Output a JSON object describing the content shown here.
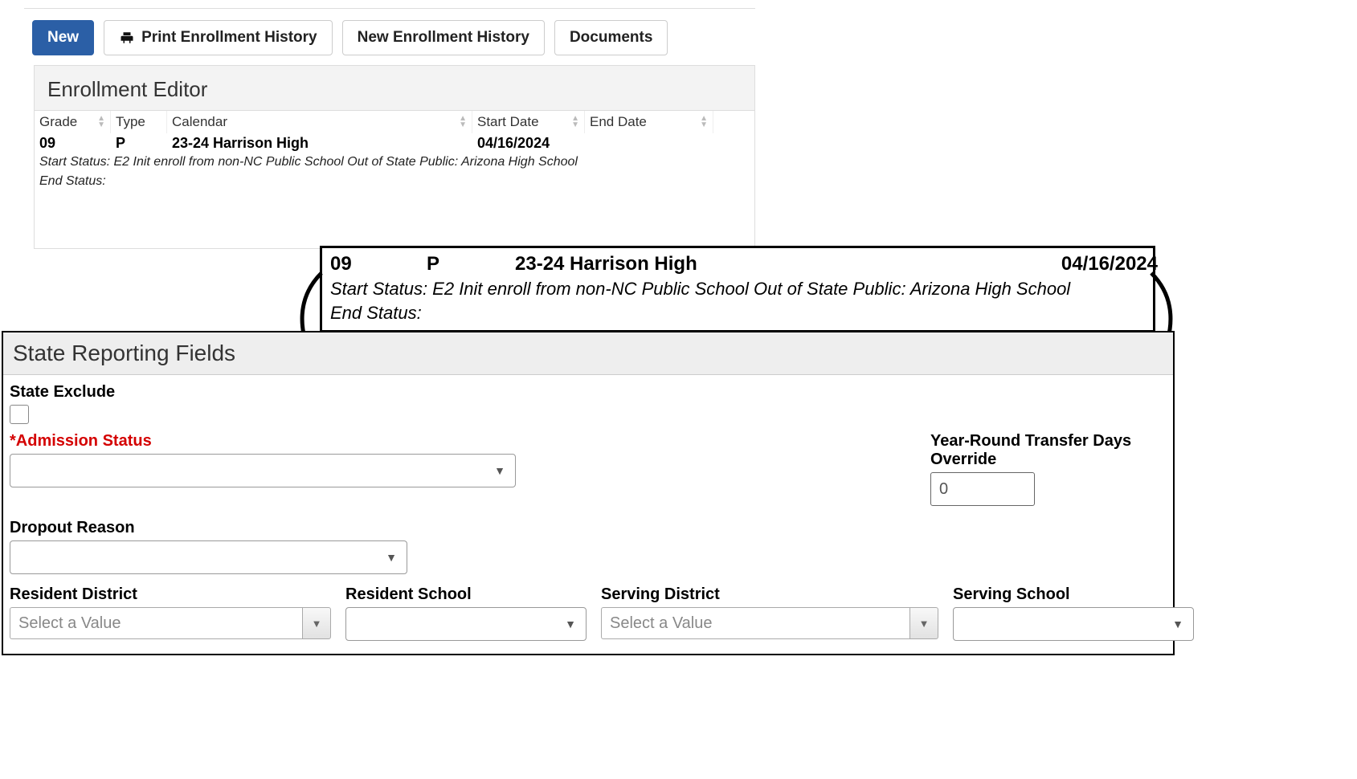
{
  "toolbar": {
    "new": "New",
    "print": "Print Enrollment History",
    "new_history": "New Enrollment History",
    "documents": "Documents"
  },
  "editor": {
    "title": "Enrollment Editor",
    "headers": {
      "grade": "Grade",
      "type": "Type",
      "calendar": "Calendar",
      "start": "Start Date",
      "end": "End Date"
    },
    "row": {
      "grade": "09",
      "type": "P",
      "calendar": "23-24 Harrison High",
      "start": "04/16/2024",
      "end": ""
    },
    "start_status": "Start Status: E2 Init enroll from non-NC Public School Out of State Public: Arizona High School",
    "end_status": "End Status:"
  },
  "callout": {
    "grade": "09",
    "type": "P",
    "calendar": "23-24 Harrison High",
    "start": "04/16/2024",
    "start_status": "Start Status: E2 Init enroll from non-NC Public School Out of State Public: Arizona High School",
    "end_status": "End Status:"
  },
  "srf": {
    "title": "State Reporting Fields",
    "state_exclude": "State Exclude",
    "admission_status": "*Admission Status",
    "year_round": "Year-Round Transfer Days Override",
    "year_round_value": "0",
    "dropout": "Dropout Reason",
    "resident_district": "Resident District",
    "resident_school": "Resident School",
    "serving_district": "Serving District",
    "serving_school": "Serving School",
    "select_placeholder": "Select a Value"
  }
}
